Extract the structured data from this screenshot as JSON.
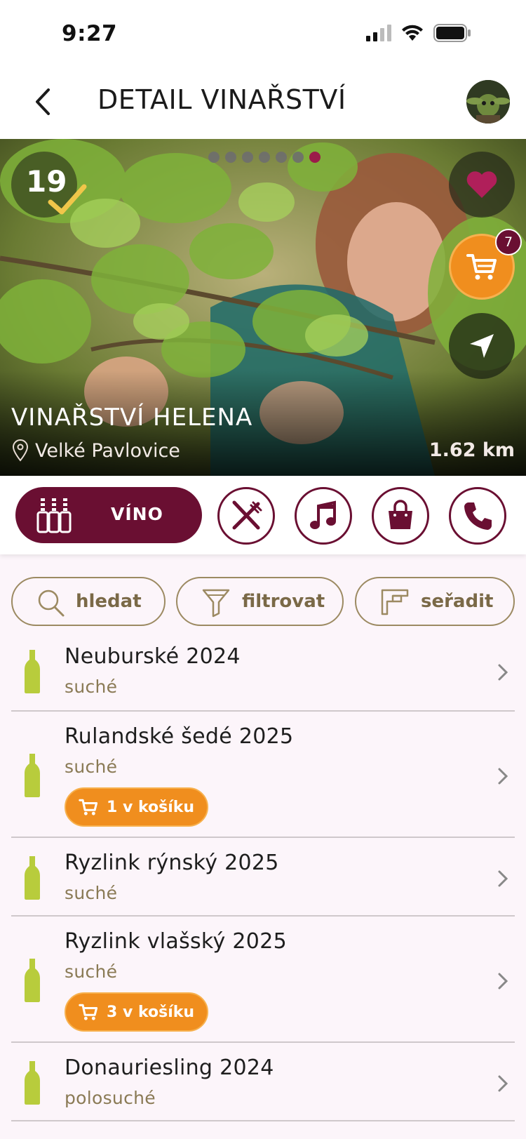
{
  "status_bar": {
    "time": "9:27"
  },
  "header": {
    "title": "DETAIL VINAŘSTVÍ"
  },
  "hero": {
    "visit_count": "19",
    "cart_count": "7",
    "winery_name": "VINAŘSTVÍ HELENA",
    "location": "Velké Pavlovice",
    "distance": "1.62 km",
    "slide_total": 7,
    "slide_active": 7
  },
  "tabs": {
    "active_label": "VÍNO",
    "icons": [
      "wine-bottles-icon",
      "fork-knife-icon",
      "music-note-icon",
      "shopping-bag-icon",
      "phone-icon"
    ]
  },
  "controls": {
    "search_label": "hledat",
    "filter_label": "filtrovat",
    "sort_label": "seřadit"
  },
  "wines": [
    {
      "name": "Neuburské 2024",
      "type": "suché"
    },
    {
      "name": "Rulandské šedé 2025",
      "type": "suché",
      "in_cart": "1 v košíku"
    },
    {
      "name": "Ryzlink rýnský 2025",
      "type": "suché"
    },
    {
      "name": "Ryzlink vlašský 2025",
      "type": "suché",
      "in_cart": "3 v košíku"
    },
    {
      "name": "Donauriesling 2024",
      "type": "polosuché"
    }
  ],
  "colors": {
    "brand_burgundy": "#6a0f32",
    "accent_orange": "#f08e1e",
    "muted_gold": "#8a7a55",
    "bottle_green": "#b8cc3c",
    "background": "#fcf5fa"
  }
}
